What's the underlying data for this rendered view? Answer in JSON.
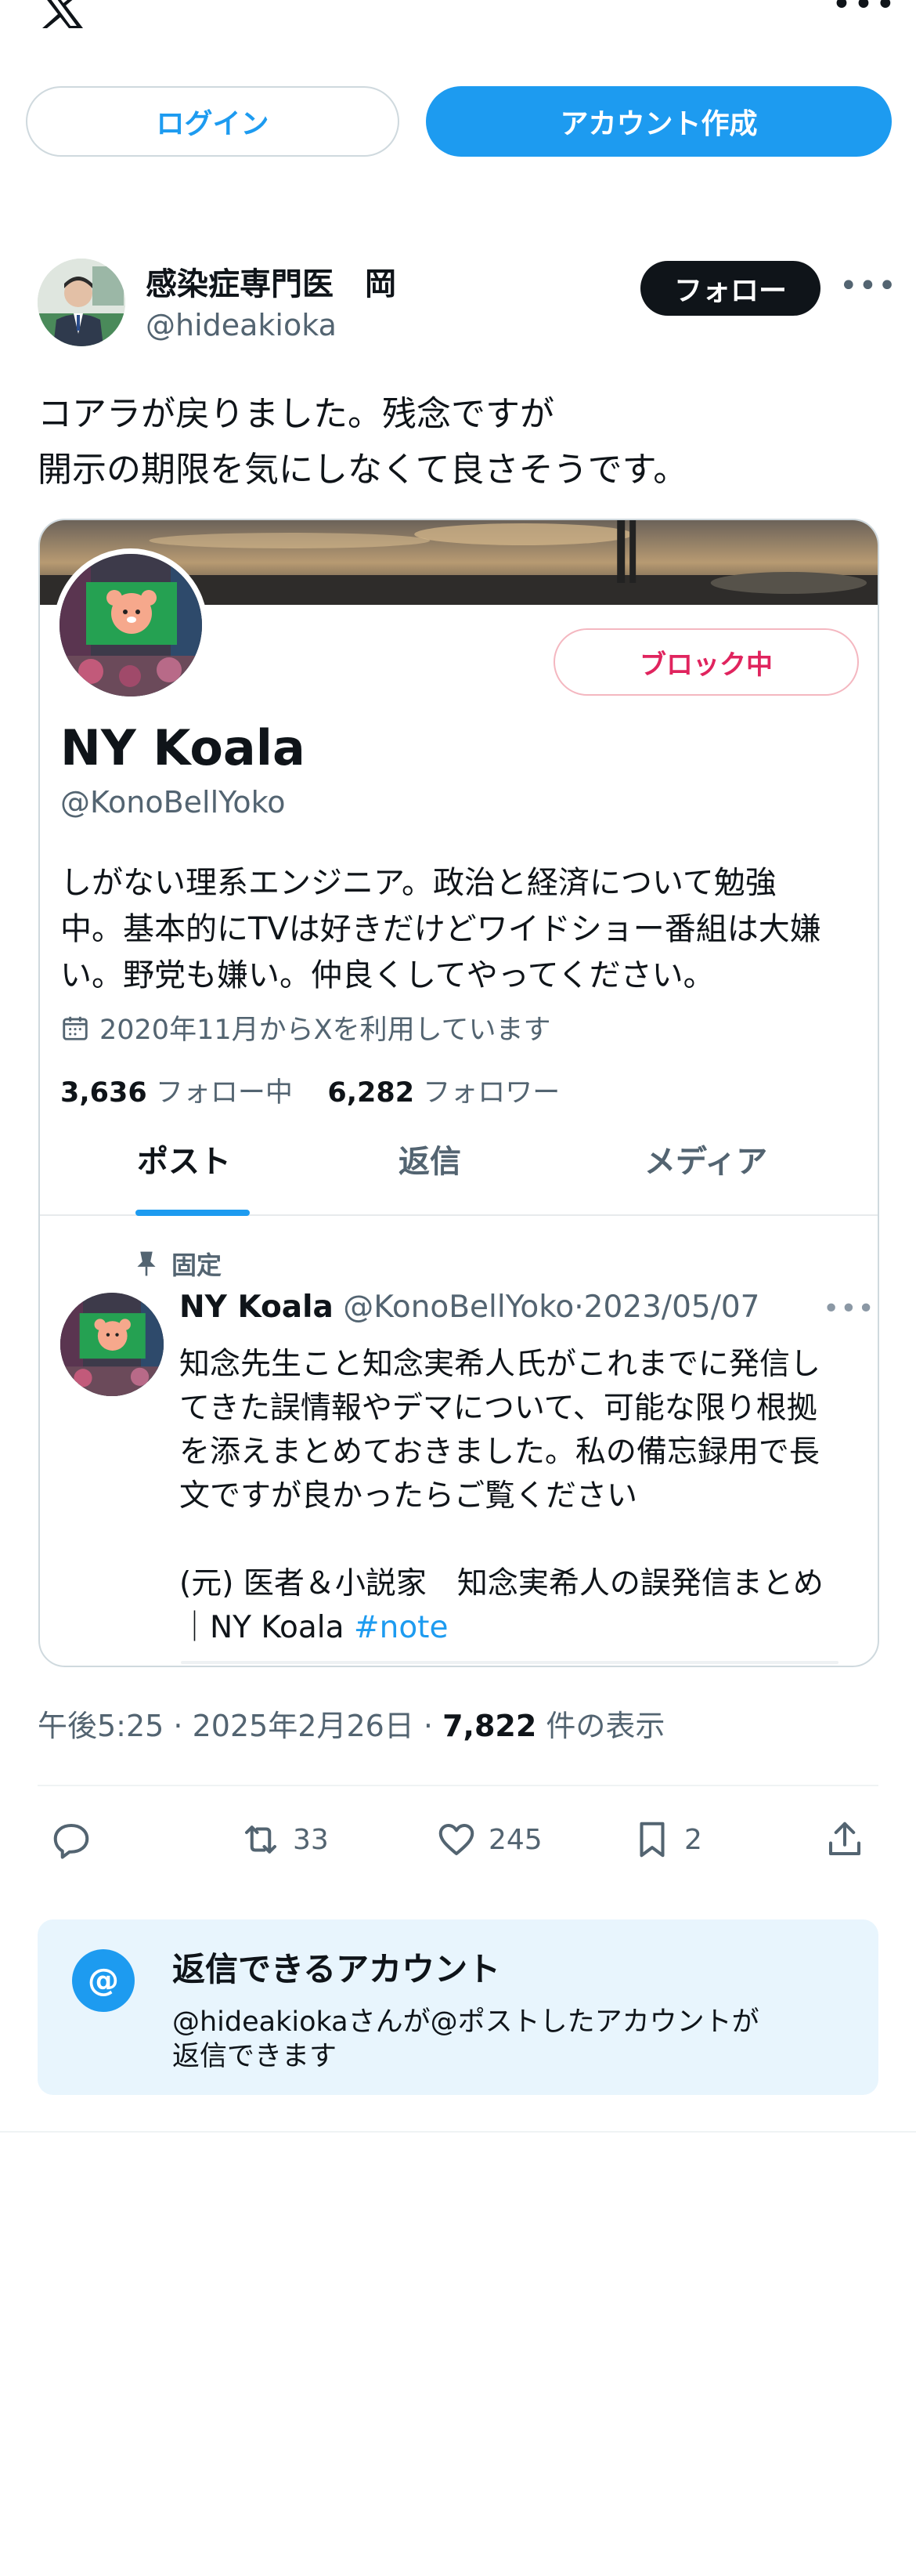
{
  "topbar": {
    "logo": "x-logo-icon",
    "more": "•••"
  },
  "auth": {
    "login_label": "ログイン",
    "signup_label": "アカウント作成"
  },
  "author": {
    "name": "感染症専門医　岡",
    "handle": "@hideakioka",
    "follow_label": "フォロー",
    "more": "•••"
  },
  "tweet": {
    "lines": [
      "コアラが戻りました。残念ですが",
      "開示の期限を気にしなくて良さそうです。"
    ]
  },
  "card": {
    "blocked_label": "ブロック中",
    "name": "NY Koala",
    "handle": "@KonoBellYoko",
    "bio": [
      "しがない理系エンジニア。政治と経済について勉強",
      "中。基本的にTVは好きだけどワイドショー番組は大嫌",
      "い。野党も嫌い。仲良くしてやってください。"
    ],
    "joined": "2020年11月からXを利用しています",
    "following_count": "3,636",
    "following_label": "フォロー中",
    "followers_count": "6,282",
    "followers_label": "フォロワー",
    "tabs": [
      "ポスト",
      "返信",
      "メディア"
    ],
    "pinned_label": "固定",
    "post": {
      "name": "NY Koala",
      "handle": "@KonoBellYoko",
      "sep": "·",
      "date": "2023/05/07",
      "more": "•••",
      "lines": [
        "知念先生こと知念実希人氏がこれまでに発信し",
        "てきた誤情報やデマについて、可能な限り根拠",
        "を添えまとめておきました。私の備忘録用で長",
        "文ですが良かったらご覧ください",
        "(元) 医者＆小説家　知念実希人の誤発信まとめ",
        "｜NY Koala "
      ],
      "hashtag": "#note"
    }
  },
  "meta": {
    "time": "午後5:25",
    "sep": " · ",
    "date": "2025年2月26日",
    "views": "7,822",
    "views_label": " 件の表示"
  },
  "actions": {
    "reply": "",
    "retweets": "33",
    "likes": "245",
    "bookmarks": "2"
  },
  "reply_box": {
    "badge": "@",
    "title": "返信できるアカウント",
    "desc": [
      "@hideakiokaさんが@ポストしたアカウントが",
      "返信できます"
    ]
  },
  "colors": {
    "accent": "#1d9bf0",
    "text": "#0f1419",
    "muted": "#536471",
    "blocked": "#e0245e"
  }
}
